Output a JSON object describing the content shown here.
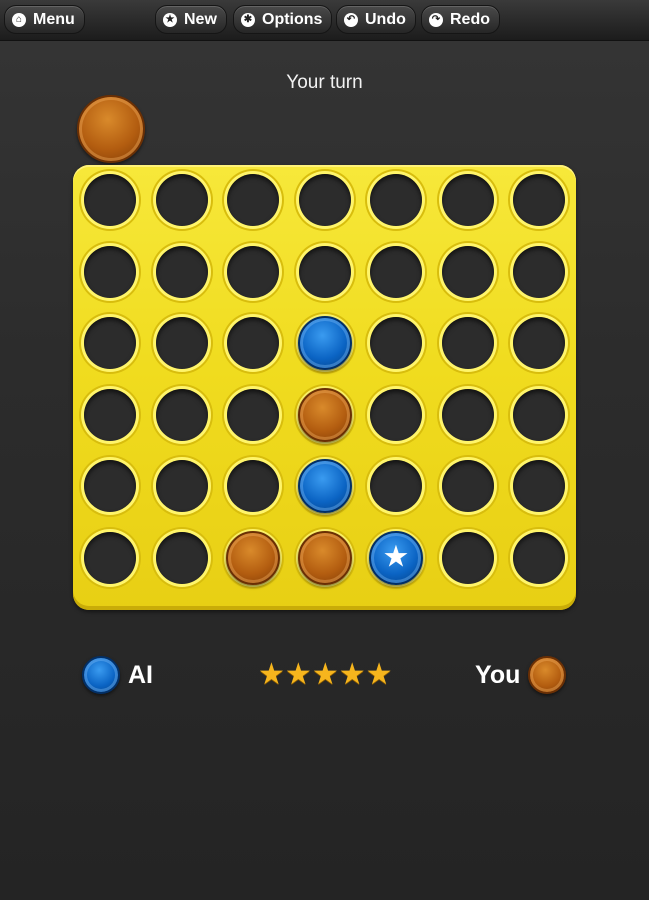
{
  "toolbar": {
    "menu": {
      "label": "Menu",
      "icon": "home-icon"
    },
    "new": {
      "label": "New",
      "icon": "star-icon"
    },
    "options": {
      "label": "Options",
      "icon": "gear-icon"
    },
    "undo": {
      "label": "Undo",
      "icon": "undo-icon"
    },
    "redo": {
      "label": "Redo",
      "icon": "redo-icon"
    }
  },
  "status": "Your turn",
  "current_piece": "orange",
  "board": {
    "columns": 7,
    "rows": 6,
    "grid": [
      [
        "",
        "",
        "",
        "",
        "",
        "",
        ""
      ],
      [
        "",
        "",
        "",
        "",
        "",
        "",
        ""
      ],
      [
        "",
        "",
        "",
        "blue",
        "",
        "",
        ""
      ],
      [
        "",
        "",
        "",
        "orange",
        "",
        "",
        ""
      ],
      [
        "",
        "",
        "",
        "blue",
        "",
        "",
        ""
      ],
      [
        "",
        "",
        "orange",
        "orange",
        "blue-star",
        "",
        ""
      ]
    ],
    "color": "#f0dc1f"
  },
  "players": {
    "ai": {
      "name": "AI",
      "color": "blue"
    },
    "you": {
      "name": "You",
      "color": "orange"
    }
  },
  "difficulty_stars": 5,
  "colors": {
    "orange": "#b35d10",
    "blue": "#0b64c4",
    "star": "#f6b51d"
  }
}
